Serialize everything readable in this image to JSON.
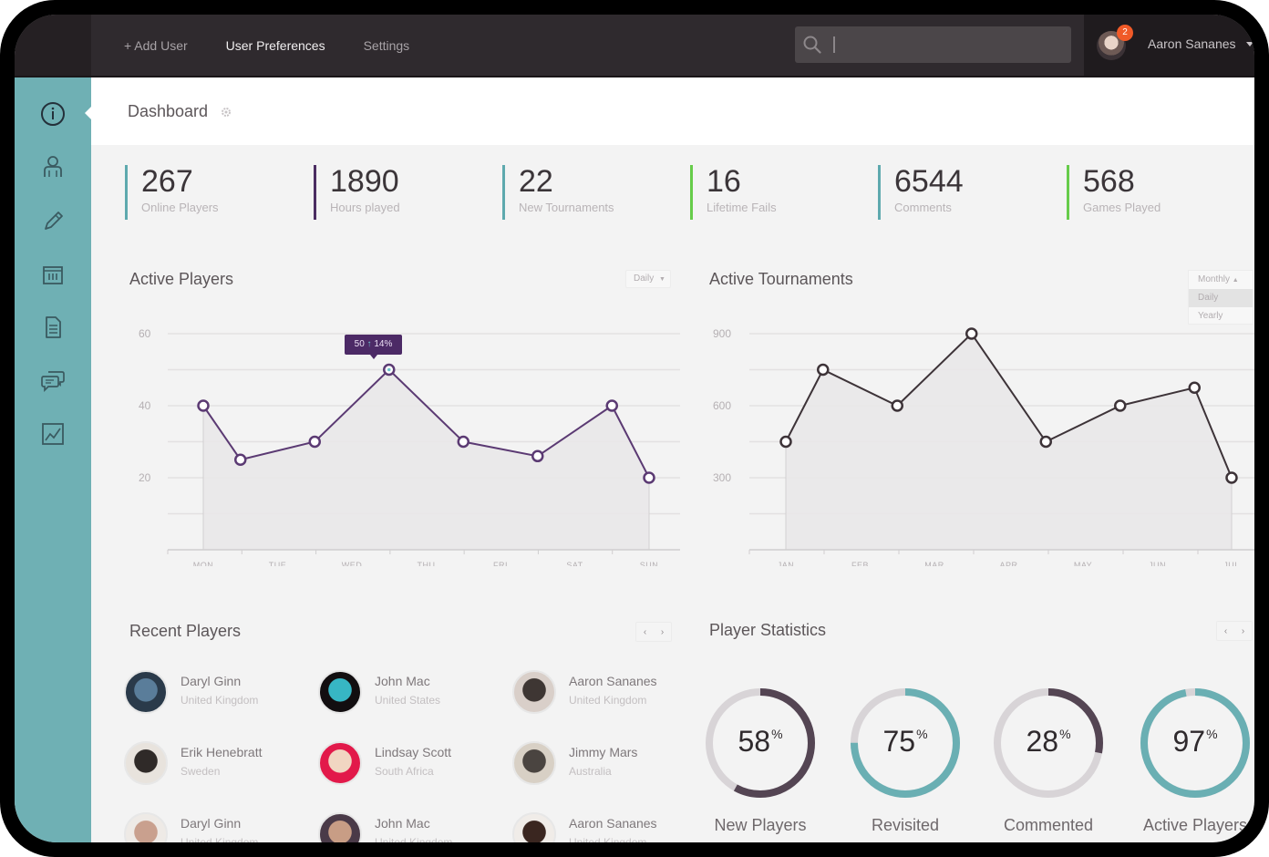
{
  "topbar": {
    "nav": [
      {
        "label": "+ Add User",
        "active": false
      },
      {
        "label": "User Preferences",
        "active": true
      },
      {
        "label": "Settings",
        "active": false
      }
    ],
    "search": {
      "value": "",
      "placeholder": "",
      "icon": "search-icon"
    },
    "user": {
      "name": "Aaron Sananes",
      "notification_count": "2"
    }
  },
  "sidebar": {
    "items": [
      {
        "icon": "info-icon",
        "active": true
      },
      {
        "icon": "user-icon",
        "active": false
      },
      {
        "icon": "pencil-icon",
        "active": false
      },
      {
        "icon": "calendar-icon",
        "active": false
      },
      {
        "icon": "document-icon",
        "active": false
      },
      {
        "icon": "chat-icon",
        "active": false
      },
      {
        "icon": "chart-icon",
        "active": false
      }
    ]
  },
  "header": {
    "title": "Dashboard",
    "icon": "gear-icon"
  },
  "stats": [
    {
      "value": "267",
      "label": "Online Players",
      "color": "#5ea9ae"
    },
    {
      "value": "1890",
      "label": "Hours played",
      "color": "#4b2d62"
    },
    {
      "value": "22",
      "label": "New Tournaments",
      "color": "#5ea9ae"
    },
    {
      "value": "16",
      "label": "Lifetime Fails",
      "color": "#66cc4a"
    },
    {
      "value": "6544",
      "label": "Comments",
      "color": "#5ea9ae"
    },
    {
      "value": "568",
      "label": "Games Played",
      "color": "#66cc4a"
    }
  ],
  "colors": {
    "teal": "#6fb0b4",
    "purple": "#5b3a73",
    "dark_purple": "#544553",
    "dark_line": "#3d3338",
    "track": "#d8d4d7",
    "topbar": "#2f2a2e"
  },
  "active_players": {
    "title": "Active Players",
    "dropdown": "Daily",
    "tooltip": {
      "value": "50",
      "arrow": "↑",
      "change": "14%"
    }
  },
  "active_tournaments": {
    "title": "Active Tournaments",
    "dropdown_options": [
      "Monthly",
      "Daily",
      "Yearly"
    ],
    "dropdown_selected": "Monthly",
    "dropdown_highlighted": "Daily"
  },
  "chart_data": [
    {
      "type": "area",
      "title": "Active Players",
      "categories": [
        "MON",
        "TUE",
        "WED",
        "THU",
        "FRI",
        "SAT",
        "SUN"
      ],
      "x_points": [
        0,
        0.5,
        1.5,
        2.5,
        3.5,
        4.5,
        5.5,
        6
      ],
      "values": [
        40,
        25,
        30,
        50,
        30,
        26,
        40,
        20
      ],
      "yticks": [
        20,
        40,
        60
      ],
      "ylim": [
        0,
        60
      ],
      "grid": true,
      "highlight_index": 3
    },
    {
      "type": "area",
      "title": "Active Tournaments",
      "categories": [
        "JAN",
        "FEB",
        "MAR",
        "APR",
        "MAY",
        "JUN",
        "JUL"
      ],
      "x_points": [
        0,
        0.5,
        1.5,
        2.5,
        3.5,
        4.5,
        5.5,
        6
      ],
      "values": [
        450,
        750,
        600,
        900,
        450,
        600,
        675,
        300
      ],
      "yticks": [
        300,
        600,
        900
      ],
      "ylim": [
        0,
        900
      ],
      "grid": true
    }
  ],
  "recent_players": {
    "title": "Recent Players",
    "pager": [
      "‹",
      "›"
    ],
    "players": [
      {
        "name": "Daryl Ginn",
        "country": "United Kingdom",
        "avatar": [
          "#2a3a4a",
          "#5a7d9a"
        ]
      },
      {
        "name": "John Mac",
        "country": "United States",
        "avatar": [
          "#120e10",
          "#37b6c4"
        ]
      },
      {
        "name": "Aaron Sananes",
        "country": "United Kingdom",
        "avatar": [
          "#d9cfc9",
          "#3e3633"
        ]
      },
      {
        "name": "Erik Henebratt",
        "country": "Sweden",
        "avatar": [
          "#e8e3dd",
          "#2f2a28"
        ]
      },
      {
        "name": "Lindsay Scott",
        "country": "South Africa",
        "avatar": [
          "#e2194a",
          "#f1d6c2"
        ]
      },
      {
        "name": "Jimmy Mars",
        "country": "Australia",
        "avatar": [
          "#d8d0c5",
          "#4a4440"
        ]
      },
      {
        "name": "Daryl Ginn",
        "country": "United Kingdom",
        "avatar": [
          "#eeeae6",
          "#c9a08e"
        ]
      },
      {
        "name": "John Mac",
        "country": "United Kingdom",
        "avatar": [
          "#4a3a48",
          "#c89d85"
        ]
      },
      {
        "name": "Aaron Sananes",
        "country": "United Kingdom",
        "avatar": [
          "#f0ece8",
          "#3a2620"
        ]
      }
    ]
  },
  "player_statistics": {
    "title": "Player Statistics",
    "pager": [
      "‹",
      "›"
    ],
    "items": [
      {
        "value": 58,
        "label": "New Players",
        "color": "#544553"
      },
      {
        "value": 75,
        "label": "Revisited",
        "color": "#6aafb3"
      },
      {
        "value": 28,
        "label": "Commented",
        "color": "#544553"
      },
      {
        "value": 97,
        "label": "Active Players",
        "color": "#6aafb3"
      }
    ],
    "unit": "%"
  }
}
